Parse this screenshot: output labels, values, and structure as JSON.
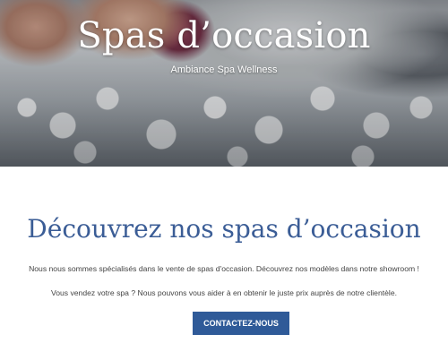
{
  "hero": {
    "title": "Spas d’occasion",
    "subtitle": "Ambiance Spa Wellness"
  },
  "main": {
    "heading": "Découvrez nos spas d’occasion",
    "paragraph1": "Nous nous sommes spécialisés dans le vente de spas d'occasion. Découvrez nos modèles dans notre showroom !",
    "paragraph2": "Vous vendez votre spa ? Nous pouvons vous aider à en obtenir le juste prix auprès de notre clientèle.",
    "cta_label": "CONTACTEZ-NOUS"
  },
  "colors": {
    "heading": "#3b5d96",
    "button": "#2f5a98",
    "text": "#444444"
  }
}
